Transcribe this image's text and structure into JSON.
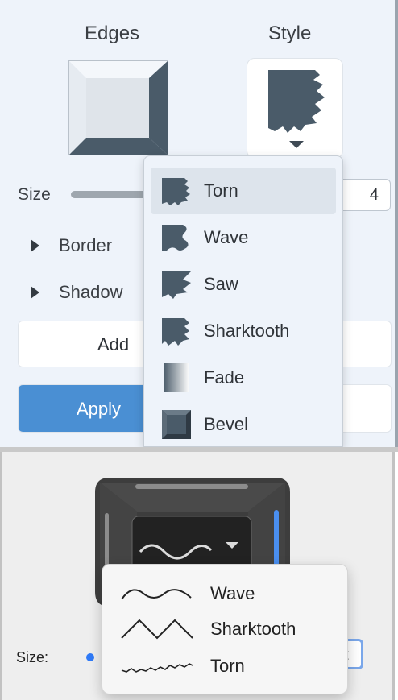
{
  "top_panel": {
    "edges_label": "Edges",
    "style_label": "Style",
    "size_label": "Size",
    "size_value": "4",
    "border_label": "Border",
    "shadow_label": "Shadow",
    "add_label": "Add",
    "apply_label": "Apply"
  },
  "style_menu": {
    "items": [
      {
        "label": "Torn",
        "icon": "torn-icon",
        "selected": true
      },
      {
        "label": "Wave",
        "icon": "wave-icon",
        "selected": false
      },
      {
        "label": "Saw",
        "icon": "saw-icon",
        "selected": false
      },
      {
        "label": "Sharktooth",
        "icon": "sharktooth-icon",
        "selected": false
      },
      {
        "label": "Fade",
        "icon": "fade-icon",
        "selected": false
      },
      {
        "label": "Bevel",
        "icon": "bevel-icon",
        "selected": false
      }
    ]
  },
  "bottom_panel": {
    "size_label": "Size:",
    "size_field_text": "t",
    "menu_items": [
      {
        "label": "Wave",
        "icon": "wave-line-icon"
      },
      {
        "label": "Sharktooth",
        "icon": "sharktooth-line-icon"
      },
      {
        "label": "Torn",
        "icon": "torn-line-icon"
      }
    ]
  },
  "colors": {
    "accent_blue": "#4a8fd3",
    "icon_slate": "#4a5b69",
    "panel_bg": "#eef3fa"
  }
}
